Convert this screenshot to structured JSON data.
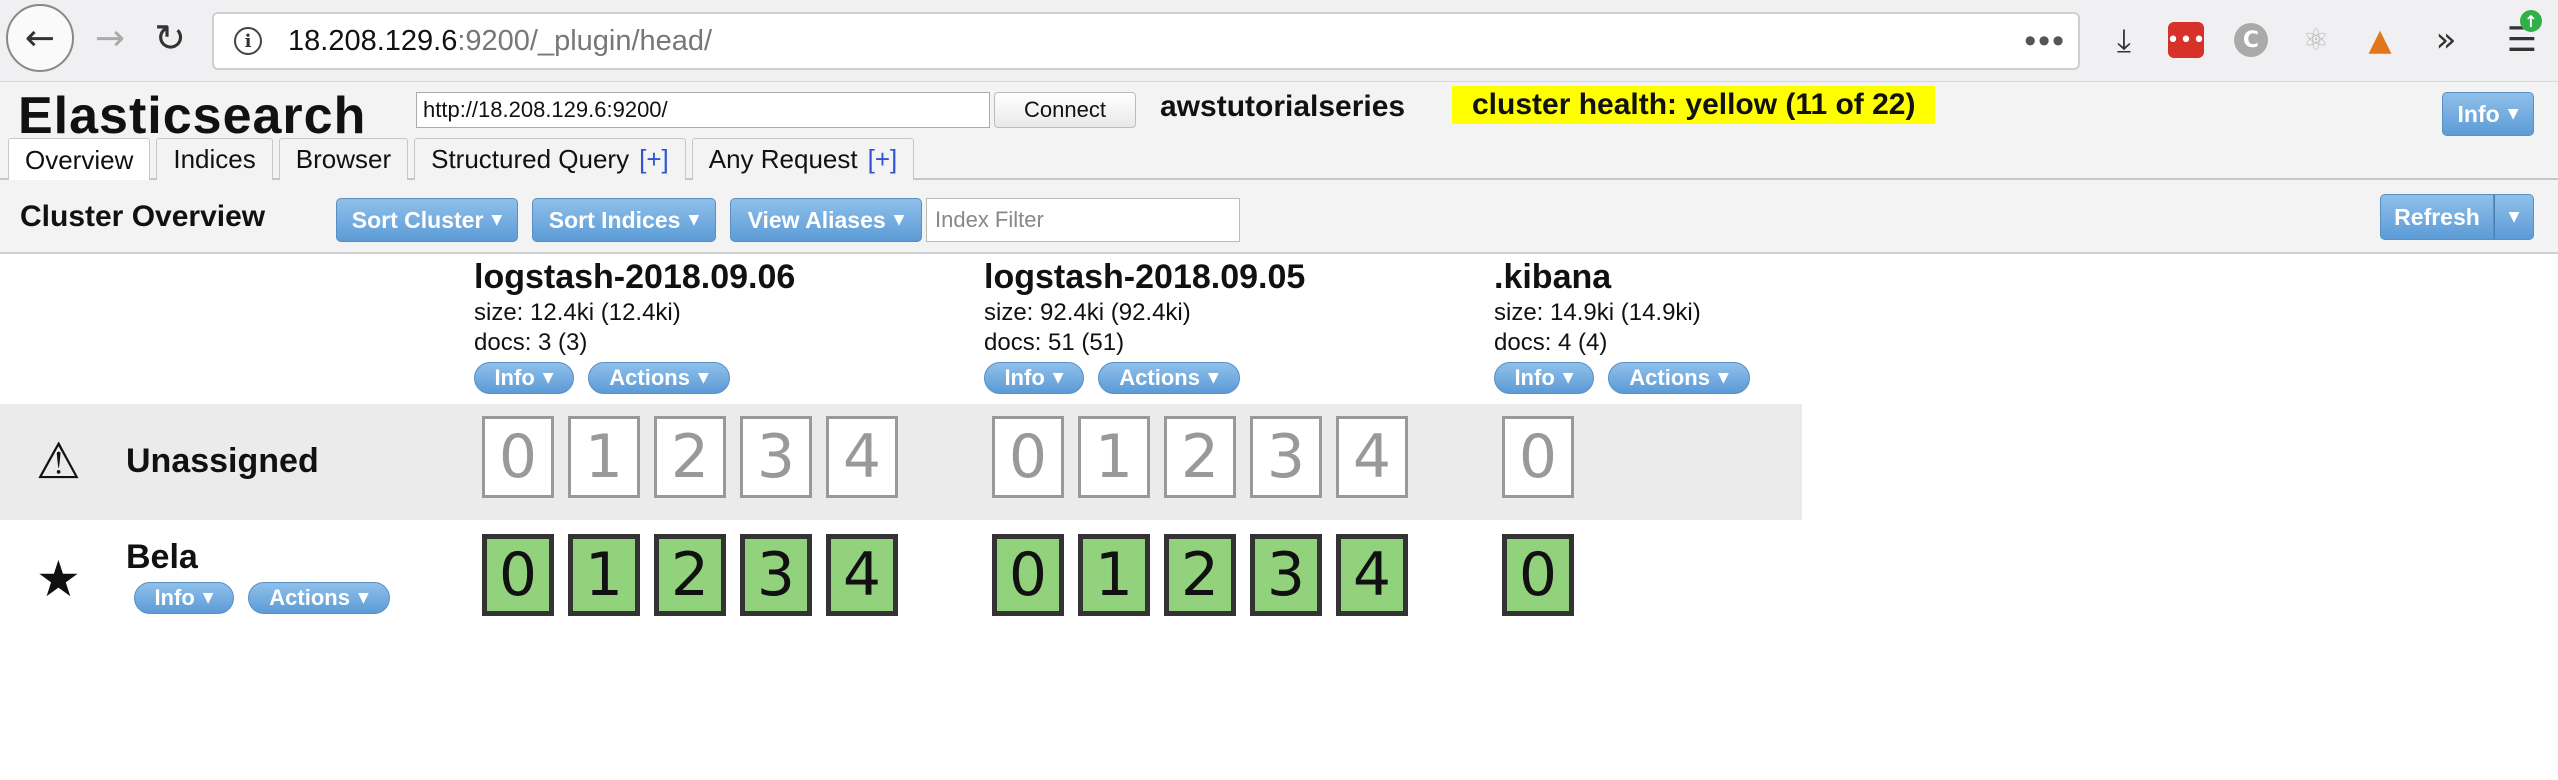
{
  "browser": {
    "url_host": "18.208.129.6",
    "url_path": ":9200/_plugin/head/",
    "more_glyph": "•••",
    "icons": [
      "back-arrow-icon",
      "forward-arrow-icon",
      "reload-icon",
      "site-info-icon",
      "download-icon",
      "extension-icon",
      "extension-c-icon",
      "react-icon",
      "metamask-fox-icon",
      "overflow-chevron-icon",
      "hamburger-menu-icon"
    ],
    "badge_glyph": "↑"
  },
  "header": {
    "title": "Elasticsearch",
    "connect_url": "http://18.208.129.6:9200/",
    "connect_label": "Connect",
    "cluster_name": "awstutorialseries",
    "health": "cluster health: yellow (11 of 22)",
    "health_color": "#ffff00",
    "info_label": "Info"
  },
  "tabs": [
    {
      "label": "Overview",
      "plus": ""
    },
    {
      "label": "Indices",
      "plus": ""
    },
    {
      "label": "Browser",
      "plus": ""
    },
    {
      "label": "Structured Query",
      "plus": "[+]"
    },
    {
      "label": "Any Request",
      "plus": "[+]"
    }
  ],
  "overview": {
    "title": "Cluster Overview",
    "sort_cluster": "Sort Cluster",
    "sort_indices": "Sort Indices",
    "view_aliases": "View Aliases",
    "filter_placeholder": "Index Filter",
    "refresh": "Refresh"
  },
  "indices": [
    {
      "name": "logstash-2018.09.06",
      "size": "size: 12.4ki (12.4ki)",
      "docs": "docs: 3 (3)",
      "info": "Info",
      "actions": "Actions",
      "shards": [
        "0",
        "1",
        "2",
        "3",
        "4"
      ]
    },
    {
      "name": "logstash-2018.09.05",
      "size": "size: 92.4ki (92.4ki)",
      "docs": "docs: 51 (51)",
      "info": "Info",
      "actions": "Actions",
      "shards": [
        "0",
        "1",
        "2",
        "3",
        "4"
      ]
    },
    {
      "name": ".kibana",
      "size": "size: 14.9ki (14.9ki)",
      "docs": "docs: 4 (4)",
      "info": "Info",
      "actions": "Actions",
      "shards": [
        "0"
      ]
    }
  ],
  "rows": {
    "unassigned_label": "Unassigned",
    "node_label": "Bela",
    "node_info": "Info",
    "node_actions": "Actions",
    "started_color": "#92d27c"
  }
}
